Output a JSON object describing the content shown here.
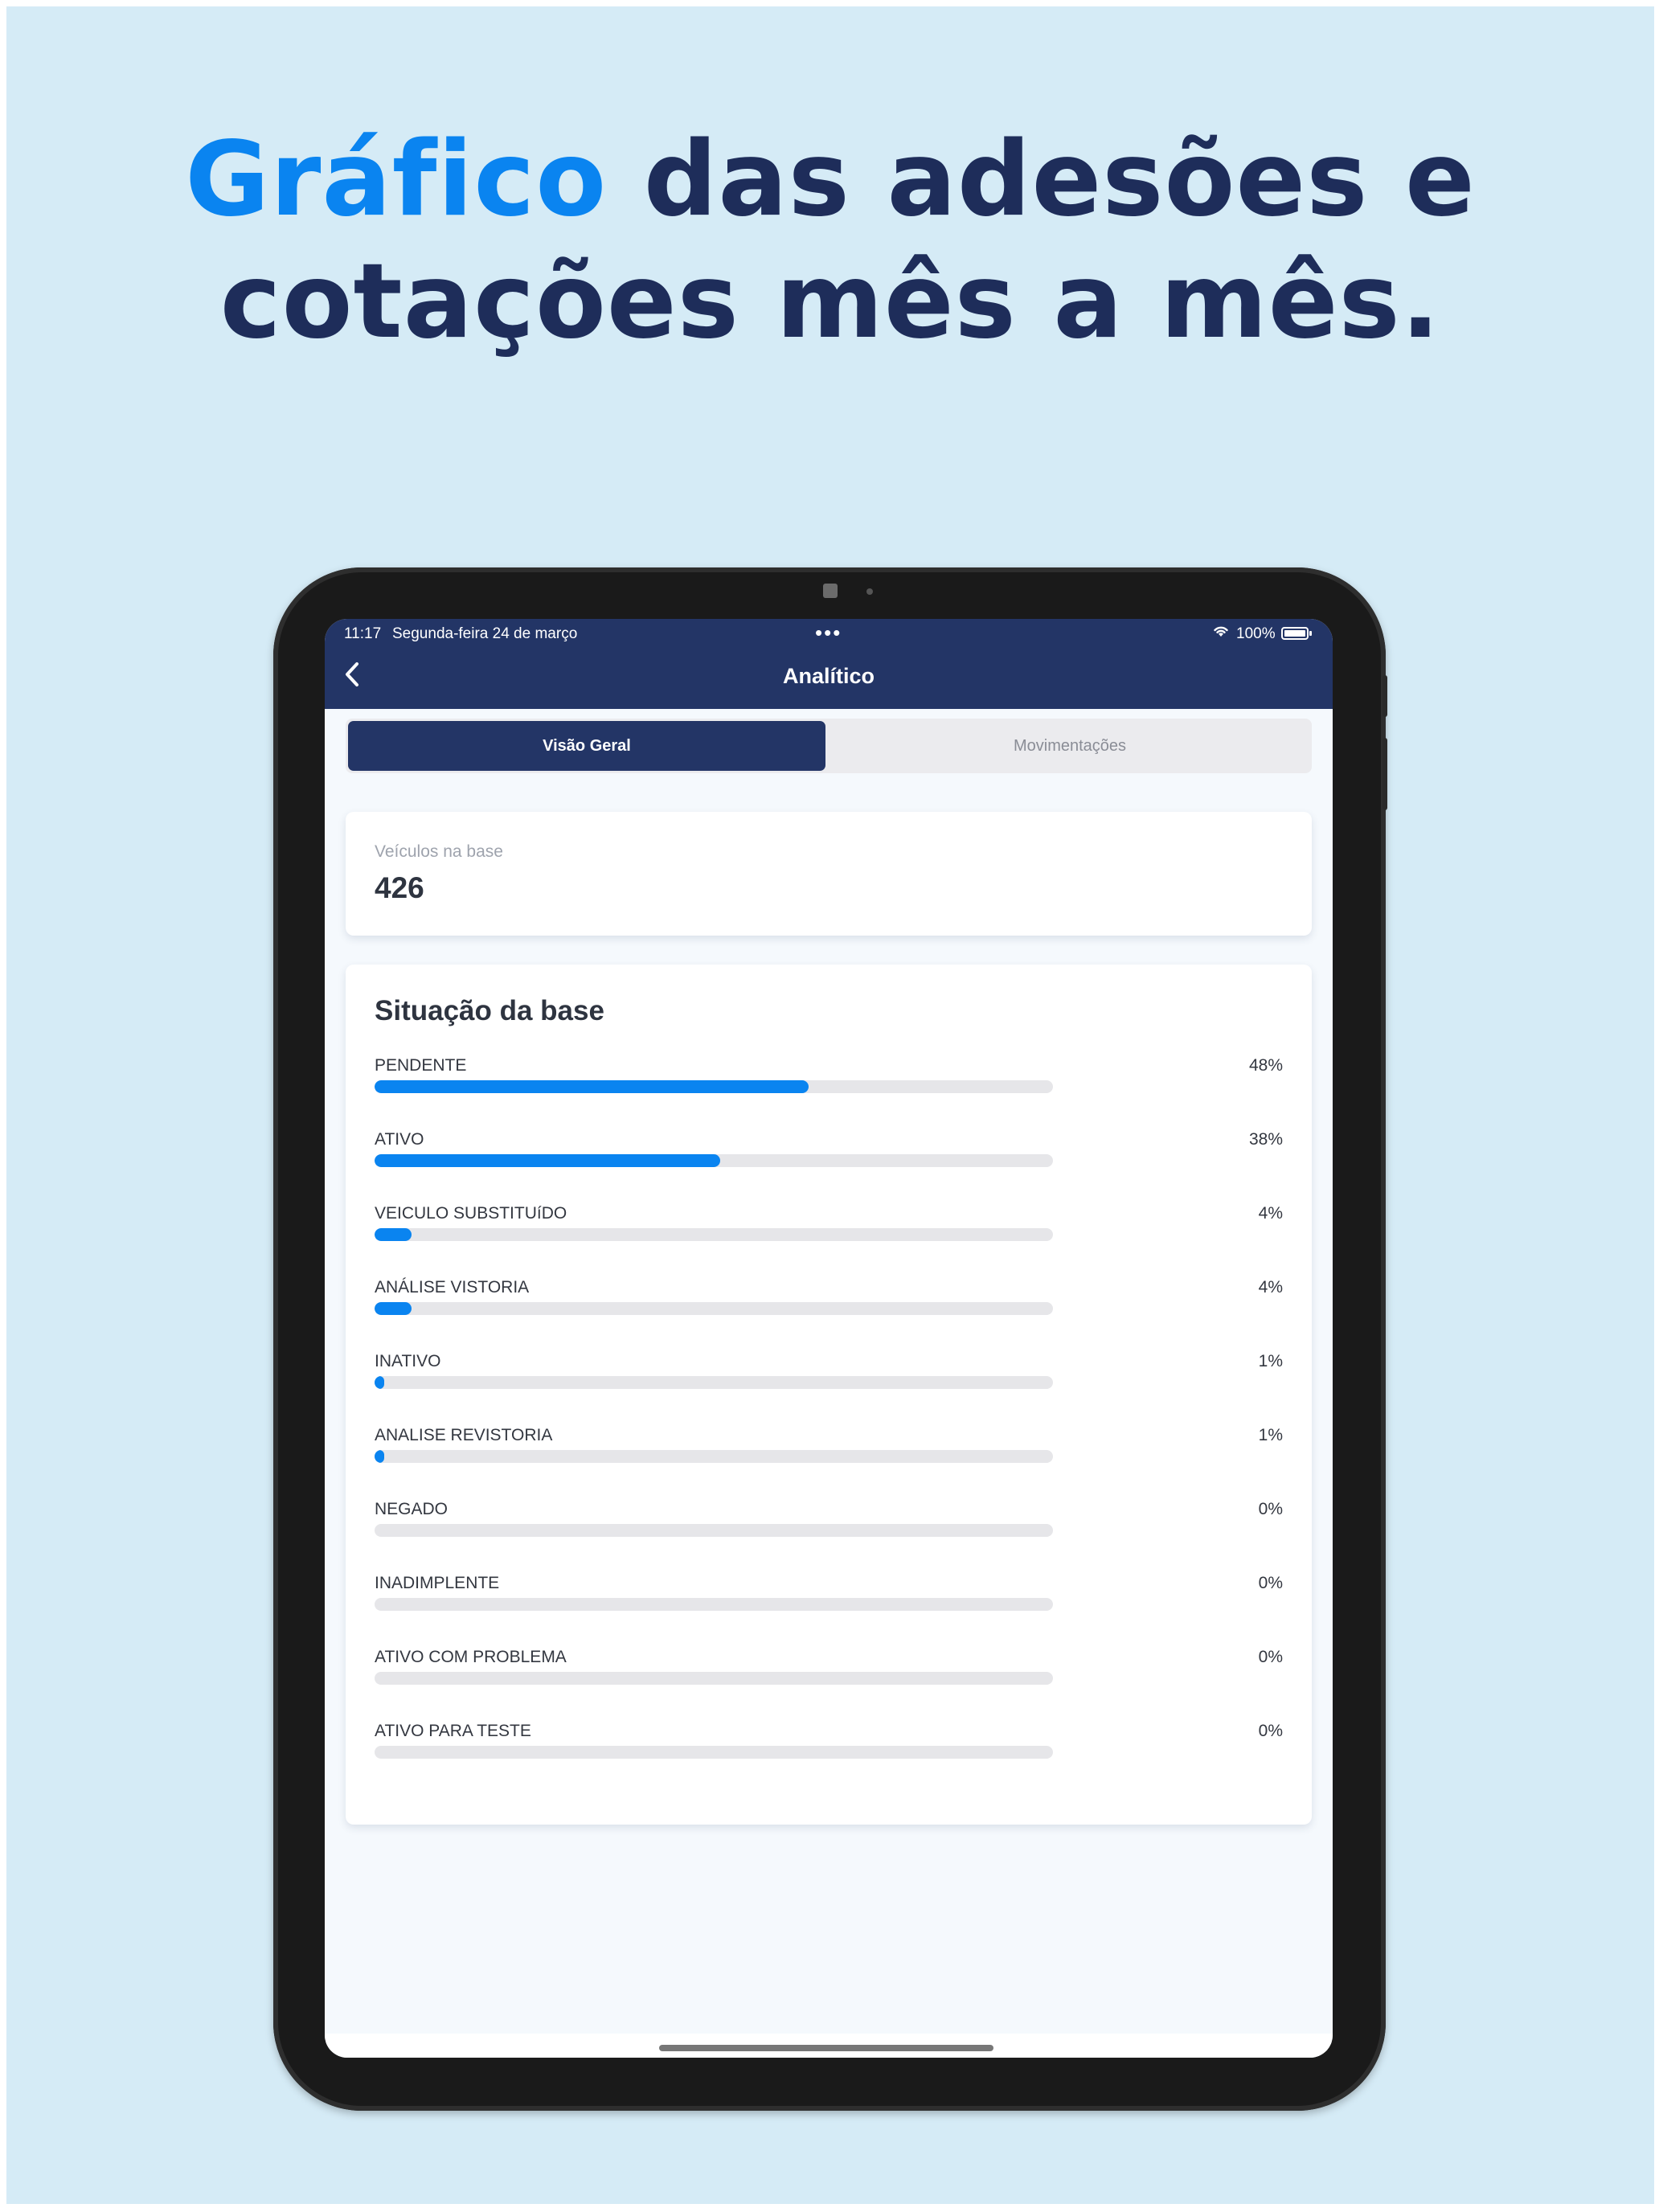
{
  "headline": {
    "accent": "Gráfico",
    "line1_rest": " das adesões e",
    "line2": "cotações mês a mês."
  },
  "status_bar": {
    "time": "11:17",
    "date": "Segunda-feira 24 de março",
    "dots": "•••",
    "battery_pct": "100%",
    "wifi_icon": "wifi-icon",
    "battery_icon": "battery-icon"
  },
  "navbar": {
    "title": "Analítico",
    "back_icon": "chevron-left-icon"
  },
  "tabs": [
    {
      "label": "Visão Geral",
      "active": true
    },
    {
      "label": "Movimentações",
      "active": false
    }
  ],
  "vehicles": {
    "label": "Veículos na base",
    "value": "426"
  },
  "status_card": {
    "title": "Situação da base",
    "items": [
      {
        "label": "PENDENTE",
        "pct": "48%",
        "fill": 0.64
      },
      {
        "label": "ATIVO",
        "pct": "38%",
        "fill": 0.51
      },
      {
        "label": "VEICULO SUBSTITUíDO",
        "pct": "4%",
        "fill": 0.055
      },
      {
        "label": "ANÁLISE VISTORIA",
        "pct": "4%",
        "fill": 0.055
      },
      {
        "label": "INATIVO",
        "pct": "1%",
        "fill": 0.014
      },
      {
        "label": "ANALISE REVISTORIA",
        "pct": "1%",
        "fill": 0.014
      },
      {
        "label": "NEGADO",
        "pct": "0%",
        "fill": 0
      },
      {
        "label": "INADIMPLENTE",
        "pct": "0%",
        "fill": 0
      },
      {
        "label": "ATIVO COM PROBLEMA",
        "pct": "0%",
        "fill": 0
      },
      {
        "label": "ATIVO PARA TESTE",
        "pct": "0%",
        "fill": 0
      }
    ]
  },
  "colors": {
    "navbar": "#233566",
    "accent": "#0a84f0",
    "background": "#d5ebf6",
    "headline": "#1e2d5a"
  }
}
